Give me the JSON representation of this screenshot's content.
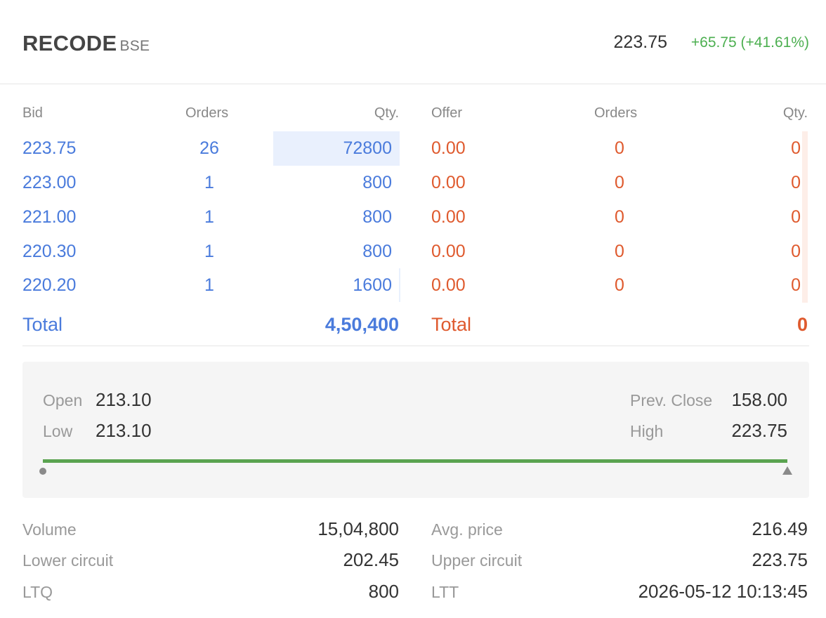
{
  "header": {
    "symbol": "RECODE",
    "exchange": "BSE",
    "ltp": "223.75",
    "change": "+65.75 (+41.61%)"
  },
  "depth": {
    "columns": {
      "bid": "Bid",
      "bid_orders": "Orders",
      "bid_qty": "Qty.",
      "offer": "Offer",
      "offer_orders": "Orders",
      "offer_qty": "Qty."
    },
    "bids": [
      {
        "price": "223.75",
        "orders": "26",
        "qty": "72800"
      },
      {
        "price": "223.00",
        "orders": "1",
        "qty": "800"
      },
      {
        "price": "221.00",
        "orders": "1",
        "qty": "800"
      },
      {
        "price": "220.30",
        "orders": "1",
        "qty": "800"
      },
      {
        "price": "220.20",
        "orders": "1",
        "qty": "1600"
      }
    ],
    "offers": [
      {
        "price": "0.00",
        "orders": "0",
        "qty": "0"
      },
      {
        "price": "0.00",
        "orders": "0",
        "qty": "0"
      },
      {
        "price": "0.00",
        "orders": "0",
        "qty": "0"
      },
      {
        "price": "0.00",
        "orders": "0",
        "qty": "0"
      },
      {
        "price": "0.00",
        "orders": "0",
        "qty": "0"
      }
    ],
    "bid_total_label": "Total",
    "bid_total": "4,50,400",
    "offer_total_label": "Total",
    "offer_total": "0"
  },
  "ohlc": {
    "open_label": "Open",
    "open": "213.10",
    "low_label": "Low",
    "low": "213.10",
    "prev_close_label": "Prev. Close",
    "prev_close": "158.00",
    "high_label": "High",
    "high": "223.75"
  },
  "stats": {
    "volume_label": "Volume",
    "volume": "15,04,800",
    "avg_price_label": "Avg. price",
    "avg_price": "216.49",
    "lower_circuit_label": "Lower circuit",
    "lower_circuit": "202.45",
    "upper_circuit_label": "Upper circuit",
    "upper_circuit": "223.75",
    "ltq_label": "LTQ",
    "ltq": "800",
    "ltt_label": "LTT",
    "ltt": "2026-05-12 10:13:45"
  },
  "colors": {
    "bid": "#4a7bdc",
    "offer": "#df5a2e",
    "positive": "#4caf50",
    "range": "#5aa350"
  }
}
